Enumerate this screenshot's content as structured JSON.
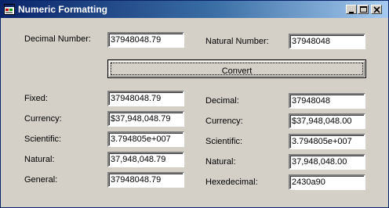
{
  "window": {
    "title": "Numeric Formatting"
  },
  "input": {
    "decimal_label": "Decimal Number:",
    "decimal_value": "37948048.79",
    "natural_label": "Natural Number:",
    "natural_value": "37948048"
  },
  "convert_label": "Convert",
  "left": [
    {
      "label": "Fixed:",
      "value": "37948048.79"
    },
    {
      "label": "Currency:",
      "value": "$37,948,048.79"
    },
    {
      "label": "Scientific:",
      "value": "3.794805e+007"
    },
    {
      "label": "Natural:",
      "value": "37,948,048.79"
    },
    {
      "label": "General:",
      "value": "37948048.79"
    }
  ],
  "right": [
    {
      "label": "Decimal:",
      "value": "37948048"
    },
    {
      "label": "Currency:",
      "value": "$37,948,048.00"
    },
    {
      "label": "Scientific:",
      "value": "3.794805e+007"
    },
    {
      "label": "Natural:",
      "value": "37,948,048.00"
    },
    {
      "label": "Hexedecimal:",
      "value": "2430a90"
    }
  ]
}
